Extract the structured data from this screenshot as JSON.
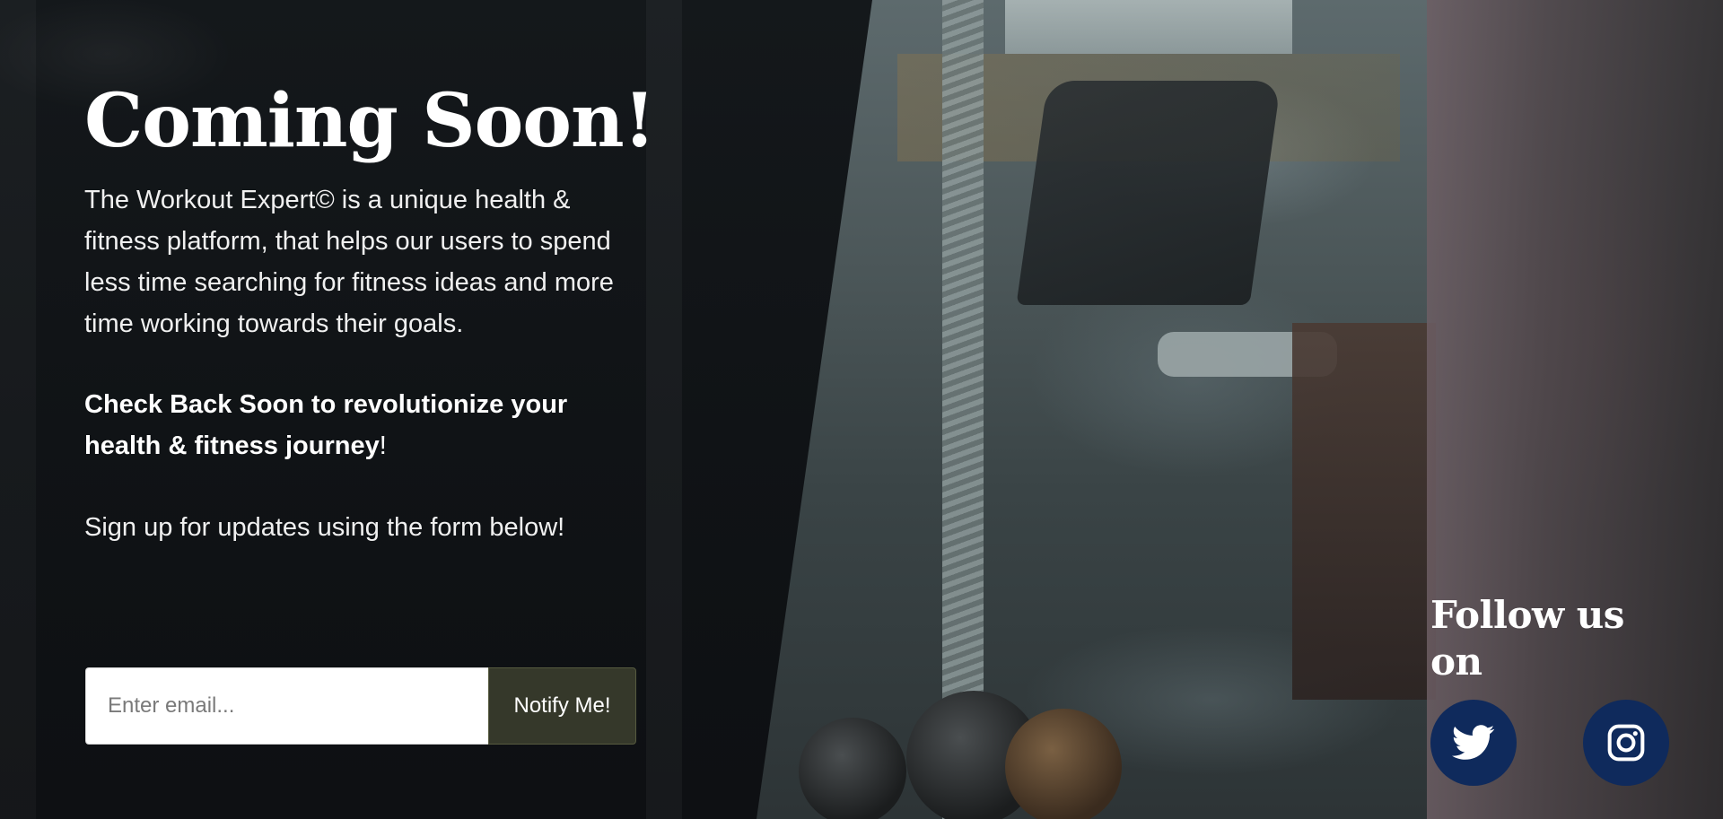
{
  "hero": {
    "title": "Coming Soon!",
    "intro": "The Workout Expert© is a unique health & fitness platform, that helps our users to spend less time searching for fitness ideas and more time working towards their goals.",
    "callout_bold": "Check Back Soon to revolutionize your health & fitness journey",
    "callout_tail": "!",
    "signup_text": "Sign up for updates using the form below!"
  },
  "form": {
    "email_placeholder": "Enter email...",
    "email_value": "",
    "notify_label": "Notify Me!"
  },
  "social": {
    "title": "Follow us on",
    "icons": [
      "twitter-icon",
      "instagram-icon"
    ],
    "button_color": "#0f2a5c"
  },
  "colors": {
    "panel": "#0e1114",
    "button": "#35382a",
    "text": "#ffffff"
  }
}
